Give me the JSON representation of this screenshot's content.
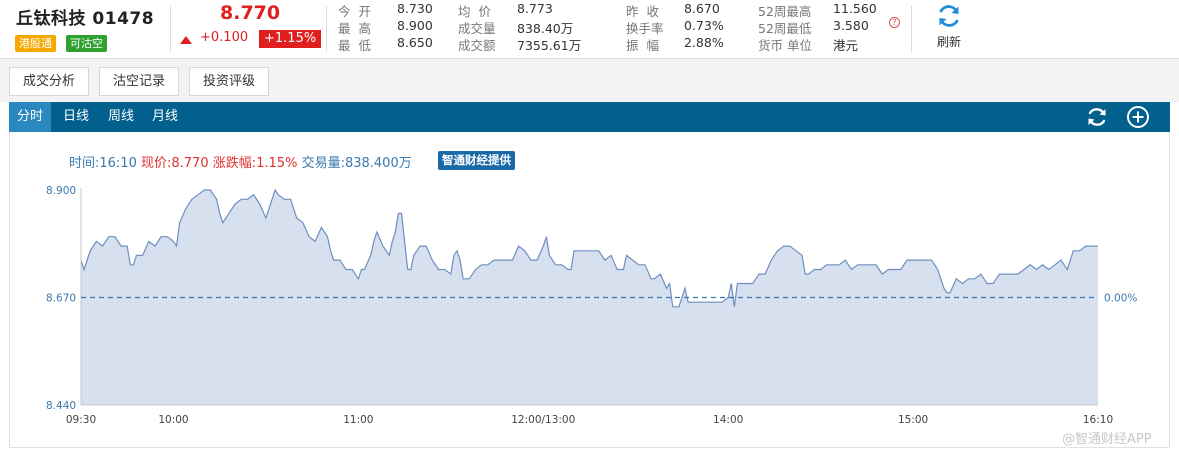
{
  "header": {
    "stock_name": "丘钛科技 01478",
    "tags": {
      "hk_connect": "港股通",
      "shortable": "可沽空"
    },
    "price": "8.770",
    "change": "+0.100",
    "change_pct": "+1.15%",
    "stats": {
      "open_label": "今  开",
      "open": "8.730",
      "high_label": "最  高",
      "high": "8.900",
      "low_label": "最  低",
      "low": "8.650",
      "avg_label": "均  价",
      "avg": "8.773",
      "volume_label": "成交量",
      "volume": "838.40万",
      "turnover_label": "成交额",
      "turnover": "7355.61万",
      "prev_close_label": "昨  收",
      "prev_close": "8.670",
      "turnover_rate_label": "换手率",
      "turnover_rate": "0.73%",
      "amplitude_label": "振  幅",
      "amplitude": "2.88%",
      "w52_high_label": "52周最高",
      "w52_high": "11.560",
      "w52_low_label": "52周最低",
      "w52_low": "3.580",
      "currency_label": "货币 单位",
      "currency": "港元"
    },
    "help_icon": "question-circle-icon",
    "refresh_label": "刷新",
    "refresh_icon": "refresh-icon"
  },
  "sub_tabs": [
    "成交分析",
    "沽空记录",
    "投资评级"
  ],
  "period_tabs": [
    "分时",
    "日线",
    "周线",
    "月线"
  ],
  "active_period": "分时",
  "bar_icons": [
    "refresh-icon",
    "add-circle-icon"
  ],
  "info_line": {
    "time": "时间:16:10",
    "price": "现价:8.770",
    "pct": "涨跌幅:1.15%",
    "volume": "交易量:838.400万",
    "badge": "智通财经提供"
  },
  "watermark": "@智通财经APP",
  "colors": {
    "up": "#e02020",
    "bar": "#02608f",
    "line": "#6f8fc0",
    "fill": "#d6e0ee",
    "baseline": "#3a78b0"
  },
  "chart_data": {
    "type": "area",
    "x_ticks": [
      "09:30",
      "10:00",
      "11:00",
      "12:00/13:00",
      "14:00",
      "15:00",
      "16:10"
    ],
    "y_ticks": [
      "8.900",
      "8.670",
      "8.440"
    ],
    "ylim": [
      8.44,
      8.9
    ],
    "reference_line": {
      "value": 8.67,
      "label": "0.00%"
    },
    "x_unit": "trading minutes from 09:30",
    "x_max": 330,
    "series": [
      {
        "points": [
          [
            0,
            8.75
          ],
          [
            1,
            8.73
          ],
          [
            3,
            8.77
          ],
          [
            5,
            8.79
          ],
          [
            7,
            8.78
          ],
          [
            9,
            8.8
          ],
          [
            11,
            8.8
          ],
          [
            13,
            8.78
          ],
          [
            15,
            8.78
          ],
          [
            16,
            8.74
          ],
          [
            17,
            8.74
          ],
          [
            18,
            8.76
          ],
          [
            20,
            8.76
          ],
          [
            22,
            8.79
          ],
          [
            24,
            8.78
          ],
          [
            26,
            8.8
          ],
          [
            28,
            8.8
          ],
          [
            30,
            8.79
          ],
          [
            31,
            8.78
          ],
          [
            32,
            8.83
          ],
          [
            34,
            8.86
          ],
          [
            36,
            8.88
          ],
          [
            38,
            8.89
          ],
          [
            40,
            8.9
          ],
          [
            42,
            8.9
          ],
          [
            43,
            8.89
          ],
          [
            44,
            8.88
          ],
          [
            45,
            8.85
          ],
          [
            46,
            8.83
          ],
          [
            48,
            8.85
          ],
          [
            50,
            8.87
          ],
          [
            52,
            8.88
          ],
          [
            54,
            8.88
          ],
          [
            56,
            8.89
          ],
          [
            58,
            8.87
          ],
          [
            60,
            8.84
          ],
          [
            62,
            8.88
          ],
          [
            63,
            8.9
          ],
          [
            64,
            8.89
          ],
          [
            66,
            8.88
          ],
          [
            68,
            8.88
          ],
          [
            70,
            8.84
          ],
          [
            72,
            8.83
          ],
          [
            74,
            8.8
          ],
          [
            76,
            8.79
          ],
          [
            78,
            8.82
          ],
          [
            80,
            8.8
          ],
          [
            81,
            8.77
          ],
          [
            82,
            8.75
          ],
          [
            84,
            8.75
          ],
          [
            86,
            8.73
          ],
          [
            88,
            8.73
          ],
          [
            90,
            8.71
          ],
          [
            91,
            8.73
          ],
          [
            92,
            8.73
          ],
          [
            94,
            8.76
          ],
          [
            95,
            8.79
          ],
          [
            96,
            8.81
          ],
          [
            98,
            8.78
          ],
          [
            100,
            8.76
          ],
          [
            101,
            8.79
          ],
          [
            102,
            8.81
          ],
          [
            103,
            8.85
          ],
          [
            104,
            8.85
          ],
          [
            105,
            8.79
          ],
          [
            106,
            8.73
          ],
          [
            107,
            8.73
          ],
          [
            108,
            8.76
          ],
          [
            110,
            8.78
          ],
          [
            112,
            8.78
          ],
          [
            114,
            8.75
          ],
          [
            116,
            8.73
          ],
          [
            118,
            8.73
          ],
          [
            120,
            8.72
          ],
          [
            121,
            8.76
          ],
          [
            122,
            8.77
          ],
          [
            123,
            8.75
          ],
          [
            124,
            8.71
          ],
          [
            126,
            8.71
          ],
          [
            128,
            8.73
          ],
          [
            130,
            8.74
          ],
          [
            132,
            8.74
          ],
          [
            134,
            8.75
          ],
          [
            136,
            8.75
          ],
          [
            138,
            8.75
          ],
          [
            140,
            8.75
          ],
          [
            142,
            8.78
          ],
          [
            144,
            8.77
          ],
          [
            146,
            8.75
          ],
          [
            148,
            8.75
          ],
          [
            150,
            8.78
          ],
          [
            151,
            8.8
          ],
          [
            152,
            8.76
          ],
          [
            154,
            8.74
          ],
          [
            156,
            8.74
          ],
          [
            158,
            8.73
          ],
          [
            159,
            8.73
          ],
          [
            160,
            8.77
          ],
          [
            162,
            8.77
          ],
          [
            164,
            8.77
          ],
          [
            166,
            8.77
          ],
          [
            168,
            8.77
          ],
          [
            170,
            8.75
          ],
          [
            172,
            8.76
          ],
          [
            174,
            8.73
          ],
          [
            176,
            8.73
          ],
          [
            177,
            8.76
          ],
          [
            179,
            8.75
          ],
          [
            181,
            8.74
          ],
          [
            183,
            8.74
          ],
          [
            185,
            8.71
          ],
          [
            186,
            8.71
          ],
          [
            188,
            8.72
          ],
          [
            190,
            8.69
          ],
          [
            191,
            8.7
          ],
          [
            192,
            8.65
          ],
          [
            193,
            8.65
          ],
          [
            194,
            8.65
          ],
          [
            195,
            8.67
          ],
          [
            196,
            8.69
          ],
          [
            197,
            8.66
          ],
          [
            198,
            8.66
          ],
          [
            200,
            8.66
          ],
          [
            202,
            8.66
          ],
          [
            204,
            8.66
          ],
          [
            206,
            8.66
          ],
          [
            208,
            8.66
          ],
          [
            210,
            8.67
          ],
          [
            211,
            8.7
          ],
          [
            212,
            8.65
          ],
          [
            213,
            8.7
          ],
          [
            214,
            8.7
          ],
          [
            216,
            8.7
          ],
          [
            218,
            8.7
          ],
          [
            220,
            8.72
          ],
          [
            222,
            8.72
          ],
          [
            224,
            8.75
          ],
          [
            226,
            8.77
          ],
          [
            228,
            8.78
          ],
          [
            230,
            8.78
          ],
          [
            232,
            8.77
          ],
          [
            234,
            8.76
          ],
          [
            235,
            8.72
          ],
          [
            236,
            8.72
          ],
          [
            238,
            8.73
          ],
          [
            240,
            8.73
          ],
          [
            242,
            8.74
          ],
          [
            244,
            8.74
          ],
          [
            246,
            8.74
          ],
          [
            248,
            8.75
          ],
          [
            250,
            8.73
          ],
          [
            252,
            8.74
          ],
          [
            254,
            8.74
          ],
          [
            256,
            8.74
          ],
          [
            258,
            8.74
          ],
          [
            260,
            8.72
          ],
          [
            262,
            8.73
          ],
          [
            264,
            8.73
          ],
          [
            266,
            8.73
          ],
          [
            268,
            8.75
          ],
          [
            270,
            8.75
          ],
          [
            272,
            8.75
          ],
          [
            274,
            8.75
          ],
          [
            276,
            8.75
          ],
          [
            278,
            8.73
          ],
          [
            280,
            8.69
          ],
          [
            281,
            8.68
          ],
          [
            282,
            8.68
          ],
          [
            284,
            8.71
          ],
          [
            286,
            8.7
          ],
          [
            288,
            8.71
          ],
          [
            290,
            8.71
          ],
          [
            292,
            8.72
          ],
          [
            294,
            8.7
          ],
          [
            296,
            8.7
          ],
          [
            298,
            8.72
          ],
          [
            300,
            8.72
          ],
          [
            302,
            8.72
          ],
          [
            304,
            8.72
          ],
          [
            306,
            8.73
          ],
          [
            308,
            8.74
          ],
          [
            310,
            8.73
          ],
          [
            312,
            8.74
          ],
          [
            314,
            8.73
          ],
          [
            316,
            8.74
          ],
          [
            318,
            8.75
          ],
          [
            320,
            8.73
          ],
          [
            322,
            8.77
          ],
          [
            324,
            8.77
          ],
          [
            326,
            8.78
          ],
          [
            328,
            8.78
          ],
          [
            330,
            8.78
          ]
        ]
      }
    ],
    "grid": false,
    "legend": "none"
  }
}
